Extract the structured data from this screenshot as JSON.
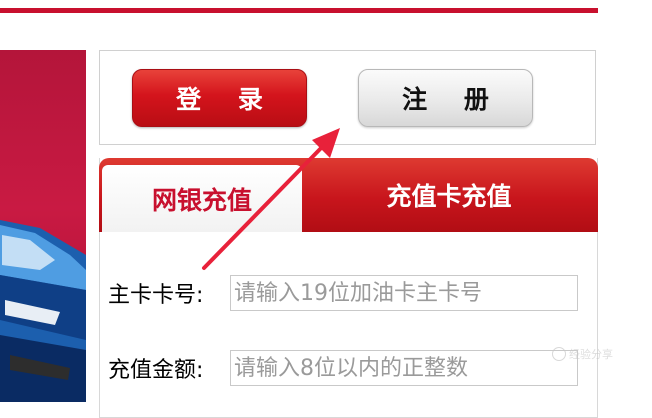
{
  "auth": {
    "login_label": "登 录",
    "register_label": "注 册"
  },
  "tabs": {
    "bank_label": "网银充值",
    "card_label": "充值卡充值"
  },
  "form": {
    "card_number_label": "主卡卡号:",
    "card_number_placeholder": "请输入19位加油卡主卡号",
    "amount_label": "充值金额:",
    "amount_placeholder": "请输入8位以内的正整数"
  },
  "watermark": {
    "text": "经验分享"
  },
  "colors": {
    "brand_red": "#c8102e",
    "annotation_arrow": "#e8213a"
  },
  "icons": {
    "annotation": "red-arrow-annotation",
    "vehicle": "car-image"
  }
}
